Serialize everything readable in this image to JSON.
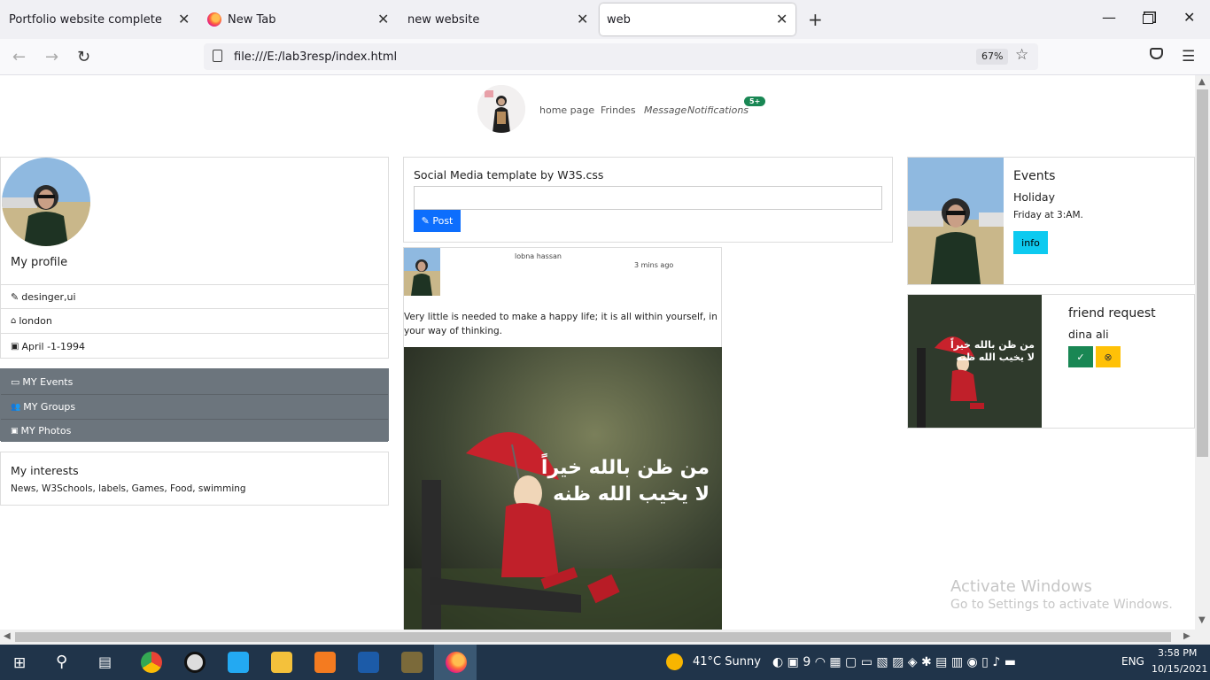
{
  "browser": {
    "tabs": [
      {
        "title": "Portfolio website complete"
      },
      {
        "title": "New Tab"
      },
      {
        "title": "new website"
      },
      {
        "title": "web"
      }
    ],
    "url": "file:///E:/lab3resp/index.html",
    "zoom": "67%"
  },
  "page": {
    "nav": {
      "home": "home page",
      "friends": "Frindes",
      "message": "Message",
      "notifications": "Notifications",
      "badge": "5+"
    },
    "profile": {
      "label": "My profile",
      "job": "desinger,ui",
      "city": "london",
      "birthday": "April -1-1994"
    },
    "menu": {
      "events": "MY Events",
      "groups": "MY Groups",
      "photos": "MY Photos"
    },
    "interests": {
      "title": "My interests",
      "list": "News, W3Schools, labels, Games, Food, swimming"
    },
    "composer": {
      "title": "Social Media template by W3S.css",
      "post_button": "Post"
    },
    "post": {
      "author": "lobna hassan",
      "time": "3 mins ago",
      "text": "Very little is needed to make a happy life; it is all within yourself, in your way of thinking.",
      "image_text_line1": "من ظن بالله خيراً",
      "image_text_line2": "لا يخيب الله ظنه"
    },
    "events": {
      "title": "Events",
      "name": "Holiday",
      "time": "Friday at 3:AM.",
      "info_button": "info"
    },
    "friend_request": {
      "title": "friend request",
      "name": "dina ali"
    }
  },
  "watermark": {
    "line1": "Activate Windows",
    "line2": "Go to Settings to activate Windows."
  },
  "taskbar": {
    "weather": "41°C  Sunny",
    "lang": "ENG",
    "time": "3:58 PM",
    "date": "10/15/2021"
  },
  "colors": {
    "post_button": "#0d6efd",
    "info_button": "#0dcaf0",
    "accept_button": "#198754",
    "reject_button": "#ffc107",
    "menu_bg": "#6c757d",
    "badge": "#198754"
  }
}
